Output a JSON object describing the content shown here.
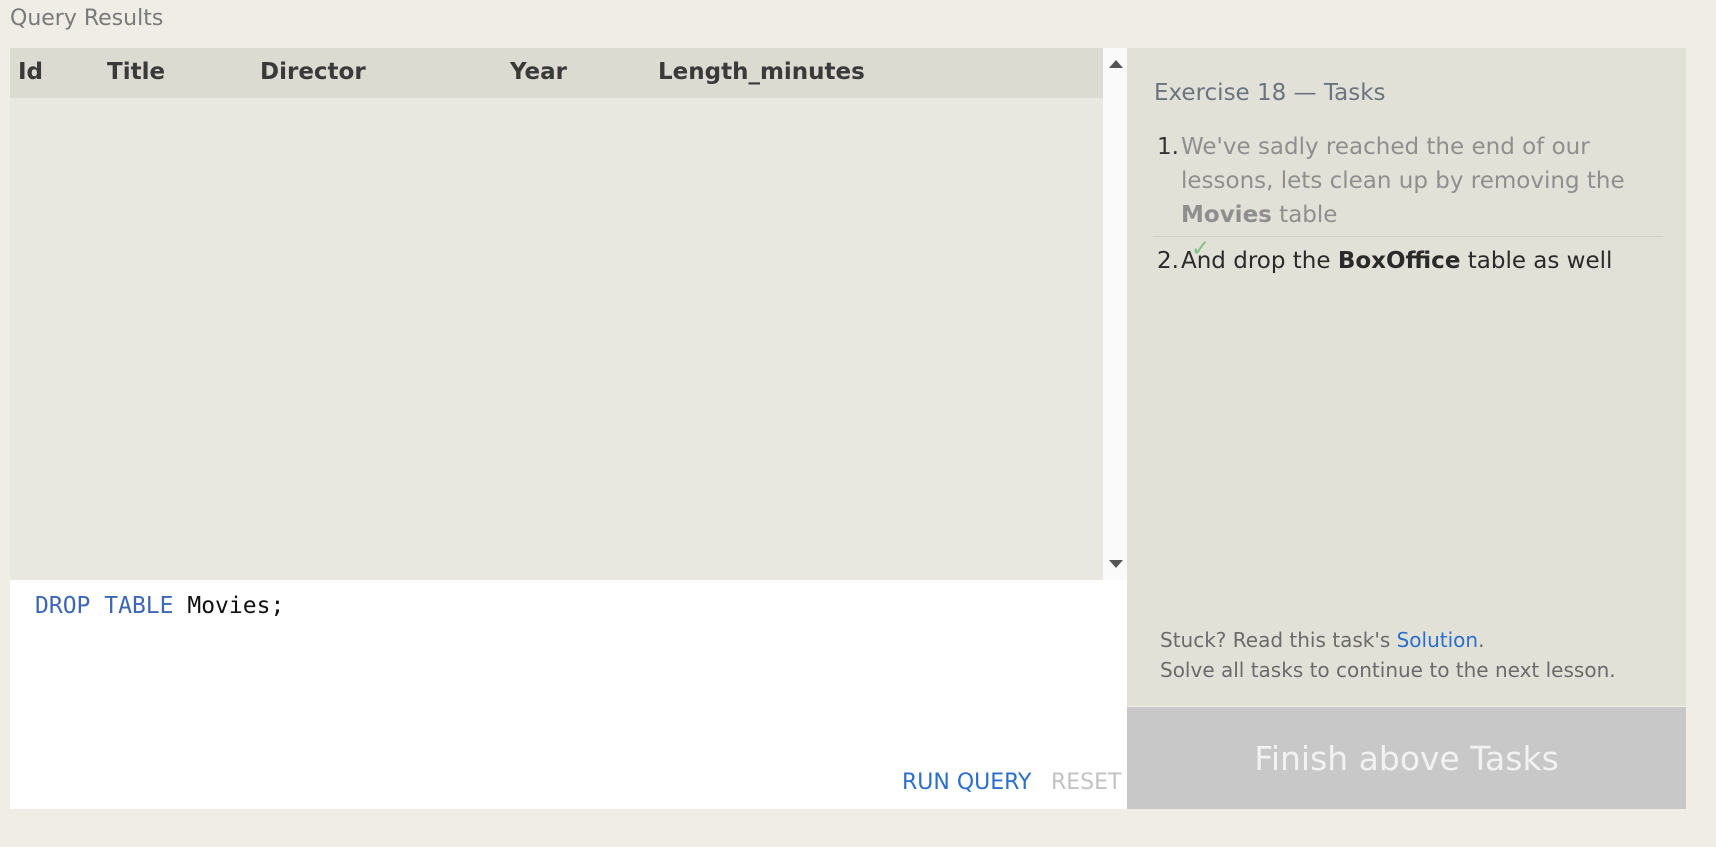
{
  "page": {
    "heading": "Query Results"
  },
  "results": {
    "columns": [
      "Id",
      "Title",
      "Director",
      "Year",
      "Length_minutes"
    ],
    "rows": []
  },
  "editor": {
    "keyword1": "DROP",
    "keyword2": "TABLE",
    "identifier": "Movies;",
    "run_label": "RUN QUERY",
    "reset_label": "RESET"
  },
  "tasks": {
    "title": "Exercise 18 — Tasks",
    "items": [
      {
        "number": "1.",
        "text_before": "We've sadly reached the end of our lessons, lets clean up by removing the ",
        "bold": "Movies",
        "text_after": " table",
        "completed": true,
        "check": "✓"
      },
      {
        "number": "2.",
        "text_before": "And drop the ",
        "bold": "BoxOffice",
        "text_after": " table as well",
        "completed": false
      }
    ],
    "help_prefix": "Stuck? Read this task's ",
    "help_link": "Solution",
    "help_suffix": ".",
    "help_line2": "Solve all tasks to continue to the next lesson.",
    "finish_label": "Finish above Tasks"
  },
  "colors": {
    "link": "#2b6fcb",
    "keyword": "#3d67b4",
    "check": "#7dc183"
  }
}
